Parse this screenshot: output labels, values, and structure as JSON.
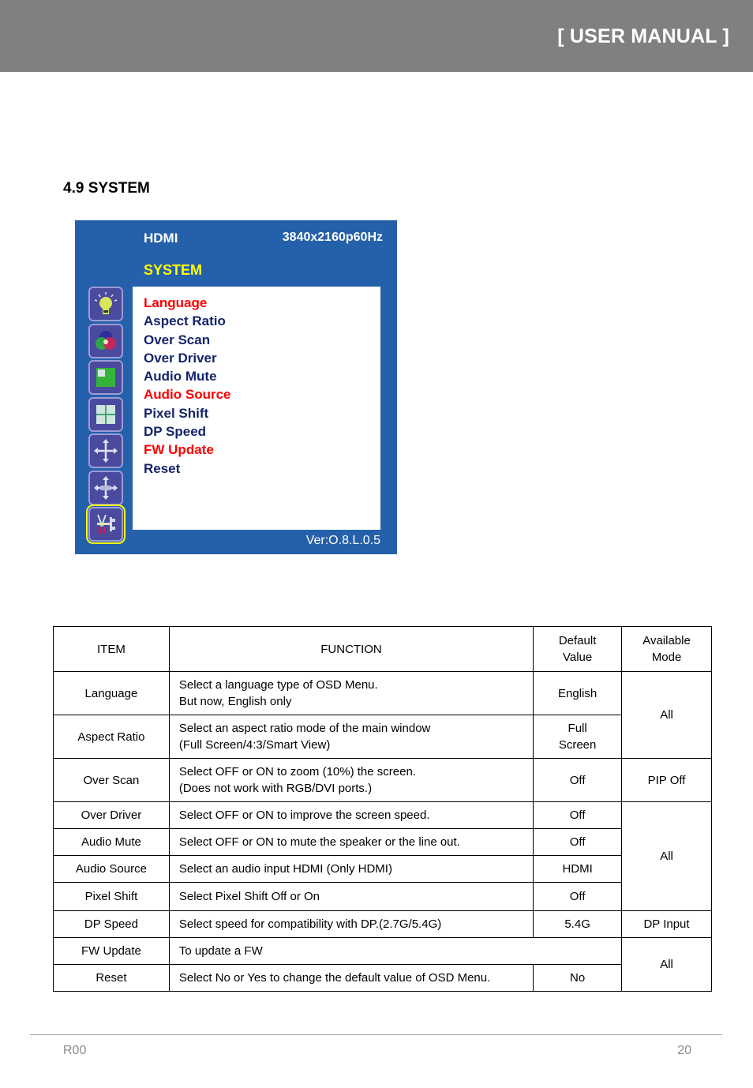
{
  "header": {
    "title": "[ USER MANUAL ]",
    "background": "#808080"
  },
  "section": {
    "title": "4.9 SYSTEM"
  },
  "osd": {
    "source": "HDMI",
    "resolution": "3840x2160p60Hz",
    "menu_title": "SYSTEM",
    "version": "Ver:O.8.L.0.5",
    "colors": {
      "background": "#2560ab",
      "title": "#ffff00",
      "item": "#14246b",
      "highlight": "#ff0000"
    },
    "side_icons": [
      {
        "name": "picture-brightness-icon",
        "selected": false
      },
      {
        "name": "color-icon",
        "selected": false
      },
      {
        "name": "pip-icon",
        "selected": false
      },
      {
        "name": "split-screen-icon",
        "selected": false
      },
      {
        "name": "position-icon",
        "selected": false
      },
      {
        "name": "size-icon",
        "selected": false
      },
      {
        "name": "system-tools-icon",
        "selected": true
      }
    ],
    "items": [
      {
        "label": "Language",
        "highlight": true
      },
      {
        "label": "Aspect Ratio",
        "highlight": false
      },
      {
        "label": "Over Scan",
        "highlight": false
      },
      {
        "label": "Over Driver",
        "highlight": false
      },
      {
        "label": "Audio Mute",
        "highlight": false
      },
      {
        "label": "Audio Source",
        "highlight": true
      },
      {
        "label": "Pixel Shift",
        "highlight": false
      },
      {
        "label": "DP Speed",
        "highlight": false
      },
      {
        "label": "FW Update",
        "highlight": true
      },
      {
        "label": "Reset",
        "highlight": false
      }
    ]
  },
  "table": {
    "headers": {
      "item": "ITEM",
      "function": "FUNCTION",
      "default_line1": "Default",
      "default_line2": "Value",
      "mode_line1": "Available",
      "mode_line2": "Mode"
    },
    "rows": [
      {
        "item": "Language",
        "function_line1": "Select a language type of OSD Menu.",
        "function_line2": "But now, English only",
        "default": "English",
        "mode": "All"
      },
      {
        "item": "Aspect Ratio",
        "function_line1": "Select an aspect ratio mode of the main window",
        "function_line2": "(Full Screen/4:3/Smart View)",
        "default_line1": "Full",
        "default_line2": "Screen"
      },
      {
        "item": "Over Scan",
        "function_line1": "Select OFF or ON to zoom (10%) the screen.",
        "function_line2": "(Does not work with RGB/DVI ports.)",
        "default": "Off",
        "mode": "PIP Off"
      },
      {
        "item": "Over Driver",
        "function": "Select OFF or ON to improve the screen speed.",
        "default": "Off",
        "mode": "All"
      },
      {
        "item": "Audio Mute",
        "function": "Select OFF or ON to mute the speaker or the line out.",
        "default": "Off"
      },
      {
        "item": "Audio Source",
        "function": "Select an audio input HDMI (Only HDMI)",
        "default": "HDMI"
      },
      {
        "item": "Pixel Shift",
        "function": "Select Pixel Shift Off or On",
        "default": "Off"
      },
      {
        "item": "DP Speed",
        "function": "Select speed for compatibility with DP.(2.7G/5.4G)",
        "default": "5.4G",
        "mode": "DP Input"
      },
      {
        "item": "FW Update",
        "function": "To update a FW",
        "mode": "All"
      },
      {
        "item": "Reset",
        "function": "Select No or Yes to change the default value of OSD Menu.",
        "default": "No"
      }
    ]
  },
  "footer": {
    "revision": "R00",
    "page_number": "20"
  }
}
